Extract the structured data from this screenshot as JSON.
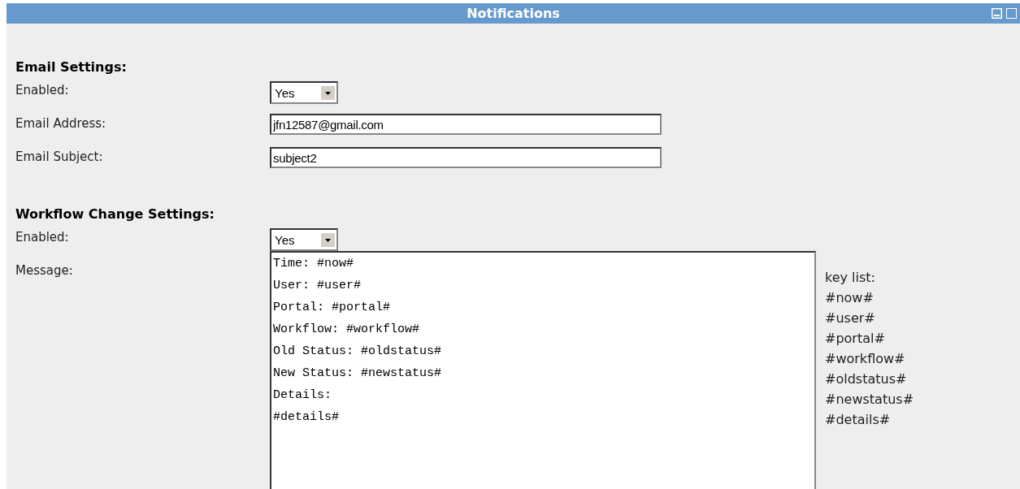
{
  "window": {
    "title": "Notifications"
  },
  "sections": [
    {
      "heading": "Email Settings:",
      "fields": [
        {
          "kind": "select",
          "label": "Enabled:",
          "value": "Yes"
        },
        {
          "kind": "text",
          "label": "Email Address:",
          "value": "jfn12587@gmail.com"
        },
        {
          "kind": "text",
          "label": "Email Subject:",
          "value": "subject2"
        }
      ]
    },
    {
      "heading": "Workflow Change Settings:",
      "fields": [
        {
          "kind": "select",
          "label": "Enabled:",
          "value": "Yes"
        },
        {
          "kind": "textarea",
          "label": "Message:",
          "value": "Time: #now#\nUser: #user#\nPortal: #portal#\nWorkflow: #workflow#\nOld Status: #oldstatus#\nNew Status: #newstatus#\nDetails:\n#details#",
          "key_list": {
            "title": "key list:",
            "keys": [
              "#now#",
              "#user#",
              "#portal#",
              "#workflow#",
              "#oldstatus#",
              "#newstatus#",
              "#details#"
            ]
          }
        }
      ]
    }
  ]
}
